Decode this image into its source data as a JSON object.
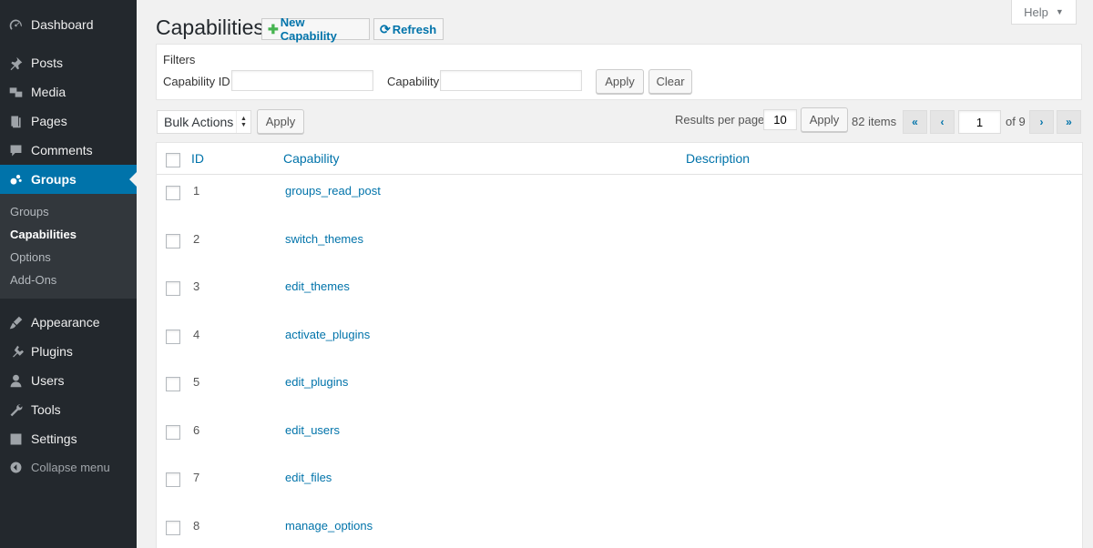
{
  "sidebar": {
    "items": [
      {
        "label": "Dashboard",
        "icon": "dashboard-icon"
      },
      {
        "label": "Posts",
        "icon": "pin-icon"
      },
      {
        "label": "Media",
        "icon": "media-icon"
      },
      {
        "label": "Pages",
        "icon": "pages-icon"
      },
      {
        "label": "Comments",
        "icon": "comment-icon"
      },
      {
        "label": "Groups",
        "icon": "groups-icon"
      },
      {
        "label": "Appearance",
        "icon": "brush-icon"
      },
      {
        "label": "Plugins",
        "icon": "plugin-icon"
      },
      {
        "label": "Users",
        "icon": "user-icon"
      },
      {
        "label": "Tools",
        "icon": "wrench-icon"
      },
      {
        "label": "Settings",
        "icon": "settings-icon"
      }
    ],
    "submenu": [
      "Groups",
      "Capabilities",
      "Options",
      "Add-Ons"
    ],
    "collapse_label": "Collapse menu"
  },
  "header": {
    "title": "Capabilities",
    "new_button": "New Capability",
    "refresh_button": "Refresh",
    "help": "Help"
  },
  "filters": {
    "heading": "Filters",
    "id_label": "Capability ID",
    "id_value": "",
    "capability_label": "Capability",
    "capability_value": "",
    "apply": "Apply",
    "clear": "Clear"
  },
  "toolbar": {
    "bulk_actions": "Bulk Actions",
    "bulk_apply": "Apply",
    "results_label": "Results per page",
    "results_value": "10",
    "results_apply": "Apply",
    "items_count": "82 items",
    "first": "«",
    "prev": "‹",
    "page_value": "1",
    "of_pages": "of 9",
    "next": "›",
    "last": "»"
  },
  "table": {
    "columns": [
      "ID",
      "Capability",
      "Description"
    ],
    "rows": [
      {
        "id": "1",
        "capability": "groups_read_post",
        "description": ""
      },
      {
        "id": "2",
        "capability": "switch_themes",
        "description": ""
      },
      {
        "id": "3",
        "capability": "edit_themes",
        "description": ""
      },
      {
        "id": "4",
        "capability": "activate_plugins",
        "description": ""
      },
      {
        "id": "5",
        "capability": "edit_plugins",
        "description": ""
      },
      {
        "id": "6",
        "capability": "edit_users",
        "description": ""
      },
      {
        "id": "7",
        "capability": "edit_files",
        "description": ""
      },
      {
        "id": "8",
        "capability": "manage_options",
        "description": ""
      }
    ]
  },
  "colors": {
    "sidebar_bg": "#23282d",
    "active_bg": "#0073aa",
    "link": "#0073aa",
    "green_plus": "#46b450"
  }
}
